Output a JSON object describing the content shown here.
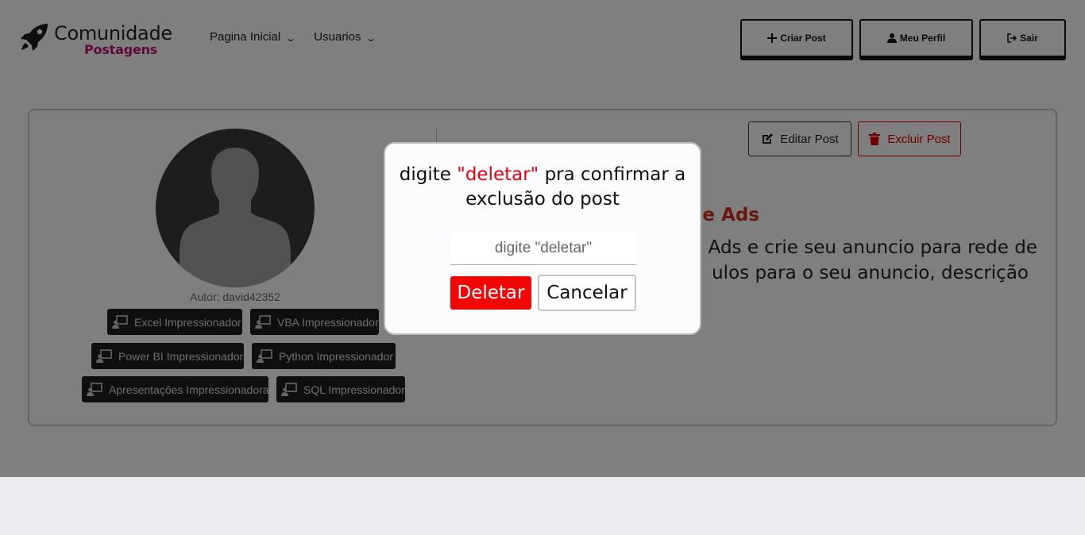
{
  "brand": {
    "title": "Comunidade",
    "subtitle": "Postagens"
  },
  "nav": {
    "items": [
      {
        "label": "Pagina Inicial"
      },
      {
        "label": "Usuarios"
      }
    ],
    "buttons": {
      "create_post": "Criar Post",
      "profile": "Meu Perfil",
      "logout": "Sair"
    }
  },
  "post": {
    "author": "Autor: david42352",
    "tags": [
      "Excel Impressionador",
      "VBA Impressionador",
      "Power BI Impressionador",
      "Python Impressionador",
      "Apresentações Impressionadora",
      "SQL Impressionador"
    ],
    "edit_label": "Editar Post",
    "delete_label": "Excluir Post",
    "title_visible": "le Ads",
    "body_line1": "Ads e crie seu anuncio para rede de",
    "body_line2": "ulos para o seu anuncio, descrição"
  },
  "modal": {
    "message_prefix": "digite ",
    "message_keyword": "\"deletar\"",
    "message_suffix": " pra confirmar a exclusão do post",
    "input_placeholder": "digite \"deletar\"",
    "input_value": "",
    "confirm_label": "Deletar",
    "cancel_label": "Cancelar"
  },
  "colors": {
    "brand_accent": "#c0136e",
    "danger": "#f20707",
    "post_title": "#d0311f"
  }
}
